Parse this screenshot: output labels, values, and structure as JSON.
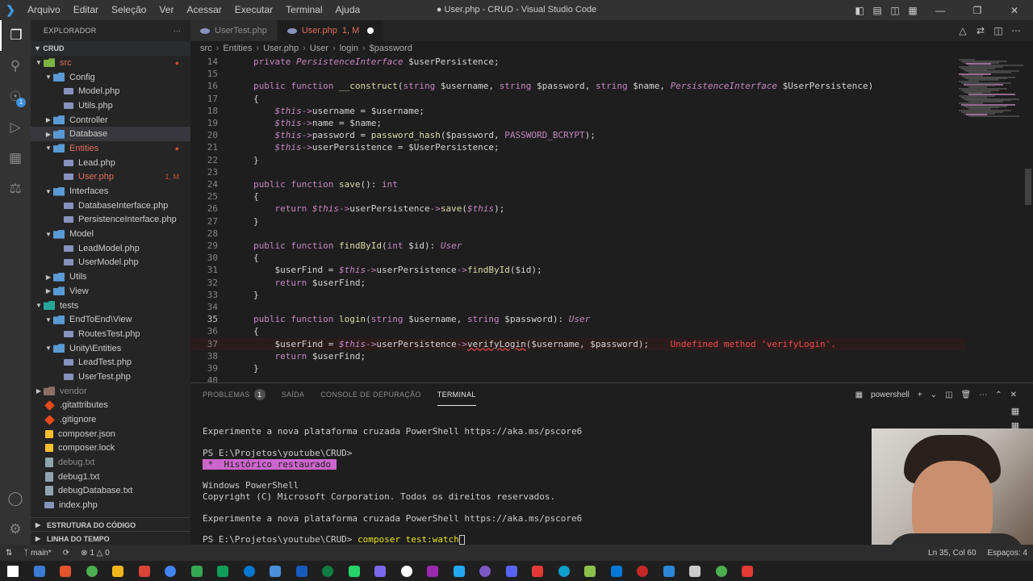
{
  "titlebar": {
    "menu": [
      "Arquivo",
      "Editar",
      "Seleção",
      "Ver",
      "Acessar",
      "Executar",
      "Terminal",
      "Ajuda"
    ],
    "title": "● User.php - CRUD - Visual Studio Code"
  },
  "sidebar": {
    "header": "EXPLORADOR",
    "root": "CRUD",
    "items": [
      {
        "label": "src",
        "type": "folder-src",
        "indent": 1,
        "open": true,
        "style": "red",
        "mod": "●"
      },
      {
        "label": "Config",
        "type": "folder",
        "indent": 2,
        "open": true
      },
      {
        "label": "Model.php",
        "type": "php",
        "indent": 3
      },
      {
        "label": "Utils.php",
        "type": "php",
        "indent": 3
      },
      {
        "label": "Controller",
        "type": "folder",
        "indent": 2,
        "open": false
      },
      {
        "label": "Database",
        "type": "folder",
        "indent": 2,
        "open": false,
        "style": "selected"
      },
      {
        "label": "Entities",
        "type": "folder",
        "indent": 2,
        "open": true,
        "style": "red",
        "mod": "●"
      },
      {
        "label": "Lead.php",
        "type": "php",
        "indent": 3
      },
      {
        "label": "User.php",
        "type": "php",
        "indent": 3,
        "style": "red",
        "mod": "1, M"
      },
      {
        "label": "Interfaces",
        "type": "folder",
        "indent": 2,
        "open": true
      },
      {
        "label": "DatabaseInterface.php",
        "type": "php",
        "indent": 3
      },
      {
        "label": "PersistenceInterface.php",
        "type": "php",
        "indent": 3
      },
      {
        "label": "Model",
        "type": "folder",
        "indent": 2,
        "open": true
      },
      {
        "label": "LeadModel.php",
        "type": "php",
        "indent": 3
      },
      {
        "label": "UserModel.php",
        "type": "php",
        "indent": 3
      },
      {
        "label": "Utils",
        "type": "folder",
        "indent": 2,
        "open": false
      },
      {
        "label": "View",
        "type": "folder",
        "indent": 2,
        "open": false
      },
      {
        "label": "tests",
        "type": "folder-tests",
        "indent": 1,
        "open": true
      },
      {
        "label": "EndToEnd\\View",
        "type": "folder",
        "indent": 2,
        "open": true
      },
      {
        "label": "RoutesTest.php",
        "type": "php",
        "indent": 3
      },
      {
        "label": "Unity\\Entities",
        "type": "folder",
        "indent": 2,
        "open": true
      },
      {
        "label": "LeadTest.php",
        "type": "php",
        "indent": 3
      },
      {
        "label": "UserTest.php",
        "type": "php",
        "indent": 3
      },
      {
        "label": "vendor",
        "type": "folder-vendor",
        "indent": 1,
        "open": false,
        "style": "grey"
      },
      {
        "label": ".gitattributes",
        "type": "git",
        "indent": 1
      },
      {
        "label": ".gitignore",
        "type": "git",
        "indent": 1
      },
      {
        "label": "composer.json",
        "type": "json",
        "indent": 1
      },
      {
        "label": "composer.lock",
        "type": "json",
        "indent": 1
      },
      {
        "label": "debug.txt",
        "type": "txt",
        "indent": 1,
        "style": "grey"
      },
      {
        "label": "debug1.txt",
        "type": "txt",
        "indent": 1
      },
      {
        "label": "debugDatabase.txt",
        "type": "txt",
        "indent": 1
      },
      {
        "label": "index.php",
        "type": "php",
        "indent": 1
      }
    ],
    "sections": [
      "ESTRUTURA DO CÓDIGO",
      "LINHA DO TEMPO"
    ]
  },
  "tabs": [
    {
      "label": "UserTest.php",
      "active": false
    },
    {
      "label": "User.php",
      "marker": "1, M",
      "active": true
    }
  ],
  "breadcrumb": [
    "src",
    "Entities",
    "User.php",
    "User",
    "login",
    "$password"
  ],
  "editor": {
    "lines": [
      {
        "n": "14",
        "html": [
          [
            "k",
            "private "
          ],
          [
            "cls",
            "PersistenceInterface "
          ],
          [
            "var",
            "$userPersistence;"
          ]
        ]
      },
      {
        "n": "15",
        "html": []
      },
      {
        "n": "16",
        "html": [
          [
            "k",
            "public function "
          ],
          [
            "fn",
            "__construct"
          ],
          [
            "pn",
            "("
          ],
          [
            "ty",
            "string "
          ],
          [
            "var",
            "$username, "
          ],
          [
            "ty",
            "string "
          ],
          [
            "var",
            "$password, "
          ],
          [
            "ty",
            "string "
          ],
          [
            "var",
            "$name, "
          ],
          [
            "cls",
            "PersistenceInterface "
          ],
          [
            "var",
            "$UserPersistence)"
          ]
        ]
      },
      {
        "n": "17",
        "html": [
          [
            "pn",
            "{"
          ]
        ]
      },
      {
        "n": "18",
        "html": [
          [
            "th",
            "    $this"
          ],
          [
            "ar",
            "->"
          ],
          [
            "var",
            "username = $username;"
          ]
        ]
      },
      {
        "n": "19",
        "html": [
          [
            "th",
            "    $this"
          ],
          [
            "ar",
            "->"
          ],
          [
            "var",
            "name = $name;"
          ]
        ]
      },
      {
        "n": "20",
        "html": [
          [
            "th",
            "    $this"
          ],
          [
            "ar",
            "->"
          ],
          [
            "var",
            "password = "
          ],
          [
            "fn",
            "password_hash"
          ],
          [
            "var",
            "($password, "
          ],
          [
            "cst",
            "PASSWORD_BCRYPT"
          ],
          [
            "var",
            ");"
          ]
        ]
      },
      {
        "n": "21",
        "html": [
          [
            "th",
            "    $this"
          ],
          [
            "ar",
            "->"
          ],
          [
            "var",
            "userPersistence = $UserPersistence;"
          ]
        ]
      },
      {
        "n": "22",
        "html": [
          [
            "pn",
            "}"
          ]
        ]
      },
      {
        "n": "23",
        "html": []
      },
      {
        "n": "24",
        "html": [
          [
            "k",
            "public function "
          ],
          [
            "fn",
            "save"
          ],
          [
            "pn",
            "(): "
          ],
          [
            "ty",
            "int"
          ]
        ]
      },
      {
        "n": "25",
        "html": [
          [
            "pn",
            "{"
          ]
        ]
      },
      {
        "n": "26",
        "html": [
          [
            "k",
            "    return "
          ],
          [
            "th",
            "$this"
          ],
          [
            "ar",
            "->"
          ],
          [
            "var",
            "userPersistence"
          ],
          [
            "ar",
            "->"
          ],
          [
            "fn",
            "save"
          ],
          [
            "var",
            "("
          ],
          [
            "th",
            "$this"
          ],
          [
            "var",
            ");"
          ]
        ]
      },
      {
        "n": "27",
        "html": [
          [
            "pn",
            "}"
          ]
        ]
      },
      {
        "n": "28",
        "html": []
      },
      {
        "n": "29",
        "html": [
          [
            "k",
            "public function "
          ],
          [
            "fn",
            "findById"
          ],
          [
            "pn",
            "("
          ],
          [
            "ty",
            "int "
          ],
          [
            "var",
            "$id): "
          ],
          [
            "cls",
            "User"
          ]
        ]
      },
      {
        "n": "30",
        "html": [
          [
            "pn",
            "{"
          ]
        ]
      },
      {
        "n": "31",
        "html": [
          [
            "var",
            "    $userFind = "
          ],
          [
            "th",
            "$this"
          ],
          [
            "ar",
            "->"
          ],
          [
            "var",
            "userPersistence"
          ],
          [
            "ar",
            "->"
          ],
          [
            "fn",
            "findById"
          ],
          [
            "var",
            "($id);"
          ]
        ]
      },
      {
        "n": "32",
        "html": [
          [
            "k",
            "    return "
          ],
          [
            "var",
            "$userFind;"
          ]
        ]
      },
      {
        "n": "33",
        "html": [
          [
            "pn",
            "}"
          ]
        ]
      },
      {
        "n": "34",
        "html": []
      },
      {
        "n": "35",
        "html": [
          [
            "k",
            "public function "
          ],
          [
            "fn",
            "login"
          ],
          [
            "pn",
            "("
          ],
          [
            "ty",
            "string "
          ],
          [
            "var",
            "$username, "
          ],
          [
            "ty",
            "string "
          ],
          [
            "var",
            "$password): "
          ],
          [
            "cls",
            "User"
          ]
        ],
        "cur": true
      },
      {
        "n": "36",
        "html": [
          [
            "pn",
            "{"
          ]
        ]
      },
      {
        "n": "37",
        "html": [
          [
            "var",
            "    $userFind = "
          ],
          [
            "th",
            "$this"
          ],
          [
            "ar",
            "->"
          ],
          [
            "var",
            "userPersistence"
          ],
          [
            "ar",
            "->"
          ],
          [
            "squig",
            "verifyLogin"
          ],
          [
            "var",
            "($username, $password);    "
          ],
          [
            "errmsg",
            "Undefined method 'verifyLogin'."
          ]
        ],
        "err": true
      },
      {
        "n": "38",
        "html": [
          [
            "k",
            "    return "
          ],
          [
            "var",
            "$userFind;"
          ]
        ]
      },
      {
        "n": "39",
        "html": [
          [
            "pn",
            "}"
          ]
        ]
      },
      {
        "n": "40",
        "html": []
      }
    ]
  },
  "panel": {
    "tabs": [
      {
        "label": "PROBLEMAS",
        "badge": "1"
      },
      {
        "label": "SAÍDA"
      },
      {
        "label": "CONSOLE DE DEPURAÇÃO"
      },
      {
        "label": "TERMINAL",
        "active": true
      }
    ],
    "shell": "powershell",
    "terminal": [
      "",
      "Experimente a nova plataforma cruzada PowerShell https://aka.ms/pscore6",
      "",
      "PS E:\\Projetos\\youtube\\CRUD>",
      "@@HL@@",
      "",
      "Windows PowerShell",
      "Copyright (C) Microsoft Corporation. Todos os direitos reservados.",
      "",
      "Experimente a nova plataforma cruzada PowerShell https://aka.ms/pscore6",
      "",
      "@@CMD@@"
    ],
    "restored": " *  Histórico restaurado ",
    "prompt": "PS E:\\Projetos\\youtube\\CRUD> ",
    "command": "composer test:watch"
  },
  "status": {
    "branch": "main*",
    "errors": "1",
    "warnings": "0",
    "position": "Ln 35, Col 60",
    "spaces": "Espaços: 4"
  },
  "taskbar_colors": [
    "#ffffff",
    "#3a7bd5",
    "#e5532d",
    "#4caf50",
    "#f2b51b",
    "#db4437",
    "#4285f4",
    "#34a853",
    "#0f9d58",
    "#0078d4",
    "#4a90d9",
    "#185abd",
    "#107c41",
    "#25d366",
    "#7b68ee",
    "#ffffff",
    "#9c27b0",
    "#23a9f2",
    "#7e57c2",
    "#5865f2",
    "#e53935",
    "#0fa0ce",
    "#8bc34a",
    "#0078d7",
    "#c62828",
    "#2b88d8",
    "#cccccc",
    "#4caf50",
    "#e53935"
  ]
}
